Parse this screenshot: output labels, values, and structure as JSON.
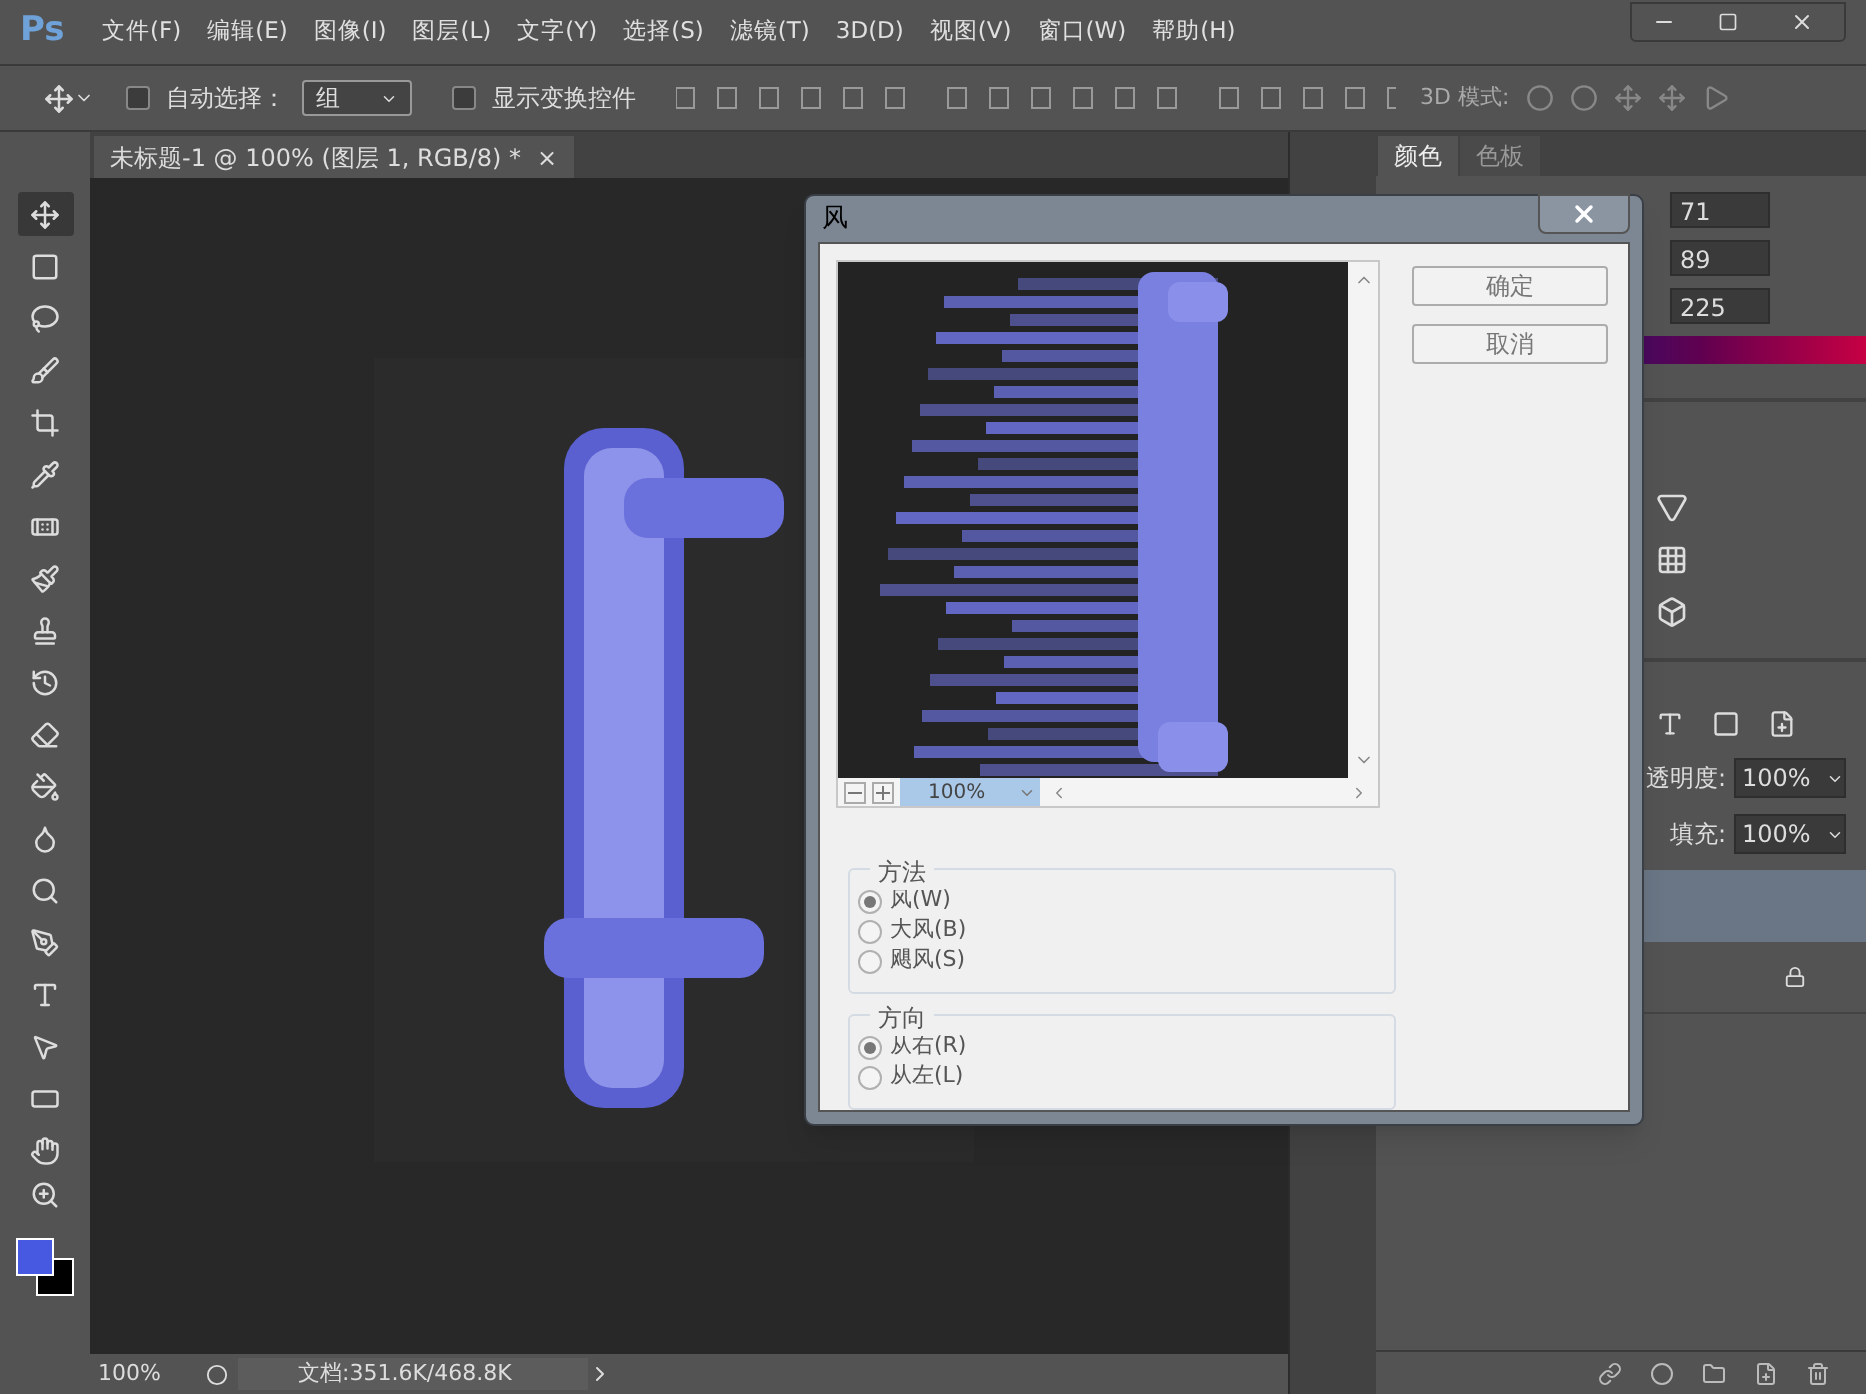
{
  "app_logo": "Ps",
  "menu": [
    "文件(F)",
    "编辑(E)",
    "图像(I)",
    "图层(L)",
    "文字(Y)",
    "选择(S)",
    "滤镜(T)",
    "3D(D)",
    "视图(V)",
    "窗口(W)",
    "帮助(H)"
  ],
  "options_bar": {
    "auto_select": {
      "label": "自动选择：",
      "checked": false
    },
    "auto_select_value": "组",
    "show_transform": {
      "label": "显示变换控件",
      "checked": false
    },
    "mode_3d": "3D 模式:"
  },
  "document_tab": {
    "title": "未标题-1 @ 100% (图层 1, RGB/8) *",
    "close": "×"
  },
  "tools": [
    {
      "selected": true
    },
    {
      "selected": false
    },
    {
      "selected": false
    },
    {
      "selected": false
    },
    {
      "selected": false
    },
    {
      "selected": false
    },
    {
      "selected": false
    },
    {
      "selected": false
    },
    {
      "selected": false
    },
    {
      "selected": false
    },
    {
      "selected": false
    },
    {
      "selected": false
    },
    {
      "selected": false
    },
    {
      "selected": false
    },
    {
      "selected": false
    },
    {
      "selected": false
    },
    {
      "selected": false
    },
    {
      "selected": false
    },
    {
      "selected": false
    }
  ],
  "color_panel": {
    "tabs": [
      {
        "label": "颜色",
        "selected": true
      },
      {
        "label": "色板",
        "selected": false
      }
    ],
    "values": [
      "71",
      "89",
      "225"
    ]
  },
  "layers_panel": {
    "opacity_label": "透明度:",
    "opacity": "100%",
    "fill_label": "填充:",
    "fill": "100%"
  },
  "dialog": {
    "title": "风",
    "zoom": "100%",
    "ok": "确定",
    "cancel": "取消",
    "method": {
      "legend": "方法",
      "options": [
        {
          "label": "风(W)",
          "selected": true
        },
        {
          "label": "大风(B)",
          "selected": false
        },
        {
          "label": "飓风(S)",
          "selected": false
        }
      ]
    },
    "direction": {
      "legend": "方向",
      "options": [
        {
          "label": "从右(R)",
          "selected": true
        },
        {
          "label": "从左(L)",
          "selected": false
        }
      ]
    }
  },
  "status_bar": {
    "zoom": "100%",
    "document": "文档:351.6K/468.8K"
  }
}
